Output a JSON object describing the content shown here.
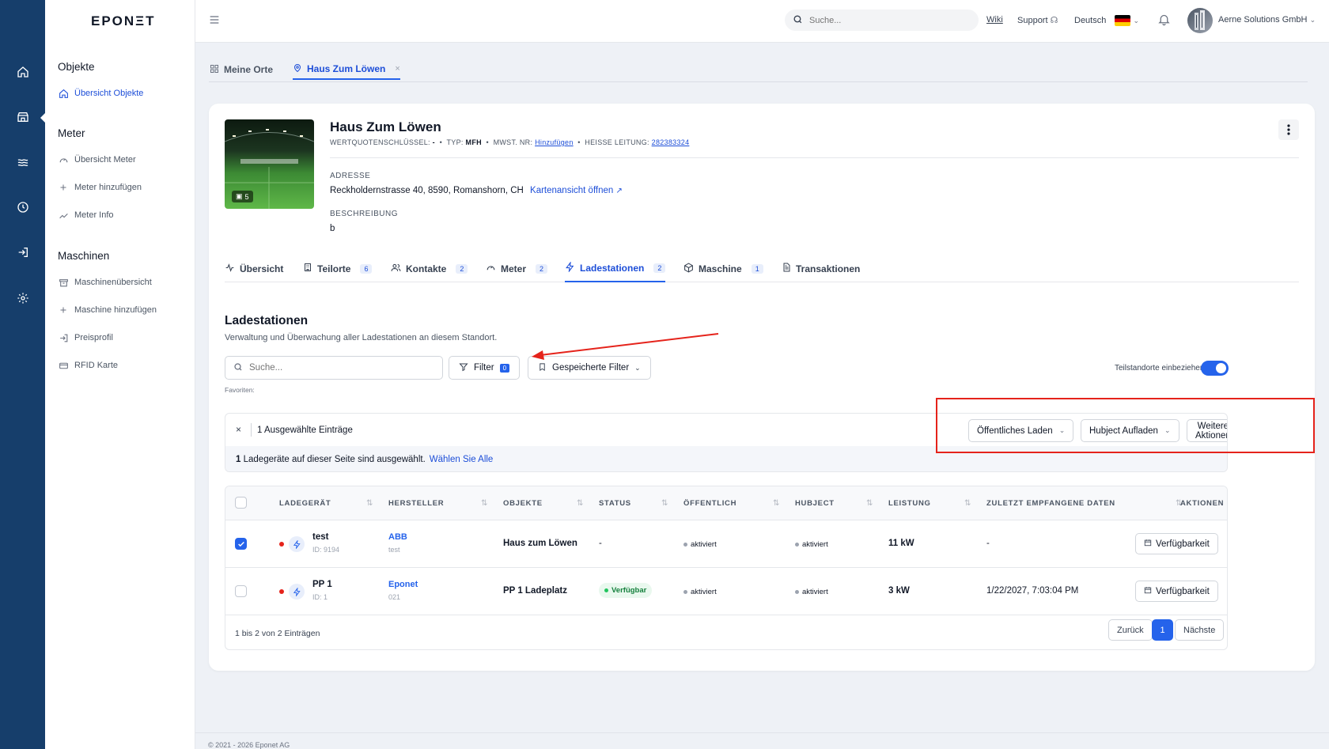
{
  "sidebar": {
    "logo": "EPONΞT",
    "sections": [
      {
        "title": "Objekte",
        "items": [
          {
            "label": "Übersicht Objekte",
            "icon": "home-icon",
            "active": true
          }
        ]
      },
      {
        "title": "Meter",
        "items": [
          {
            "label": "Übersicht Meter",
            "icon": "gauge-icon"
          },
          {
            "label": "Meter hinzufügen",
            "icon": "plus-icon"
          },
          {
            "label": "Meter Info",
            "icon": "chart-line-icon"
          }
        ]
      },
      {
        "title": "Maschinen",
        "items": [
          {
            "label": "Maschinenübersicht",
            "icon": "archive-icon"
          },
          {
            "label": "Maschine hinzufügen",
            "icon": "plus-icon"
          },
          {
            "label": "Preisprofil",
            "icon": "login-icon"
          },
          {
            "label": "RFID Karte",
            "icon": "card-icon"
          }
        ]
      }
    ]
  },
  "rail": {
    "icons": [
      "home-icon",
      "store-icon",
      "waves-icon",
      "clock-icon",
      "login-icon",
      "settings-icon"
    ]
  },
  "topbar": {
    "search_placeholder": "Suche...",
    "wiki": "Wiki",
    "support": "Support",
    "language": "Deutsch",
    "company": "Aerne Solutions GmbH"
  },
  "page_tabs": [
    {
      "label": "Meine Orte",
      "icon": "grid-icon"
    },
    {
      "label": "Haus Zum Löwen",
      "icon": "pin-icon",
      "active": true
    }
  ],
  "object": {
    "name": "Haus Zum Löwen",
    "image_count": "5",
    "meta": {
      "wq_label": "WERTQUOTENSCHLÜSSEL:",
      "wq_value": "-",
      "typ_label": "TYP:",
      "typ_value": "MFH",
      "mwst_label": "MWST. NR:",
      "mwst_link": "Hinzufügen",
      "heisse_label": "HEISSE LEITUNG:",
      "heisse_link": "282383324"
    },
    "address_label": "ADRESSE",
    "address": "Reckholdernstrasse 40, 8590, Romanshorn, CH",
    "map_link": "Kartenansicht öffnen",
    "description_label": "BESCHREIBUNG",
    "description": "b"
  },
  "sub_tabs": [
    {
      "label": "Übersicht",
      "icon": "activity-icon"
    },
    {
      "label": "Teilorte",
      "count": "6",
      "icon": "building-icon"
    },
    {
      "label": "Kontakte",
      "count": "2",
      "icon": "users-icon"
    },
    {
      "label": "Meter",
      "count": "2",
      "icon": "gauge-icon"
    },
    {
      "label": "Ladestationen",
      "count": "2",
      "icon": "bolt-icon",
      "active": true
    },
    {
      "label": "Maschine",
      "count": "1",
      "icon": "box-icon"
    },
    {
      "label": "Transaktionen",
      "icon": "document-icon"
    }
  ],
  "section": {
    "title": "Ladestationen",
    "subtitle": "Verwaltung und Überwachung aller Ladestationen an diesem Standort.",
    "search_placeholder": "Suche...",
    "filter_label": "Filter",
    "filter_count": "0",
    "saved_filter_label": "Gespeicherte Filter",
    "favorites_label": "Favoriten:",
    "toggle_label": "Teilstandorte einbeziehen",
    "toggle_on": true
  },
  "selection": {
    "text": "1 Ausgewählte Einträge",
    "count": "1",
    "info": "Ladegeräte auf dieser Seite sind ausgewählt.",
    "select_all": "Wählen Sie Alle",
    "actions": [
      "Öffentliches Laden",
      "Hubject Aufladen",
      "Weitere Aktionen"
    ]
  },
  "table": {
    "columns": [
      "LADEGERÄT",
      "HERSTELLER",
      "OBJEKTE",
      "STATUS",
      "ÖFFENTLICH",
      "HUBJECT",
      "LEISTUNG",
      "ZULETZT EMPFANGENE DATEN",
      "AKTIONEN"
    ],
    "rows": [
      {
        "checked": true,
        "name": "test",
        "id": "ID: 9194",
        "manufacturer": "ABB",
        "manufacturer_sub": "test",
        "object": "Haus zum Löwen",
        "status": "-",
        "public": "aktiviert",
        "hubject": "aktiviert",
        "power": "11 kW",
        "last_data": "-",
        "action": "Verfügbarkeit"
      },
      {
        "checked": false,
        "name": "PP 1",
        "id": "ID: 1",
        "manufacturer": "Eponet",
        "manufacturer_sub": "021",
        "object": "PP 1 Ladeplatz",
        "status": "Verfügbar",
        "public": "aktiviert",
        "hubject": "aktiviert",
        "power": "3 kW",
        "last_data": "1/22/2027, 7:03:04 PM",
        "action": "Verfügbarkeit"
      }
    ],
    "footer_info": "1 bis 2 von 2 Einträgen",
    "pagination": {
      "prev": "Zurück",
      "current": "1",
      "next": "Nächste"
    }
  },
  "footer": {
    "text": "© 2021 - 2026 Eponet AG"
  },
  "colors": {
    "rail": "#163e6b",
    "accent": "#2563eb",
    "annotation": "#e5231b"
  }
}
